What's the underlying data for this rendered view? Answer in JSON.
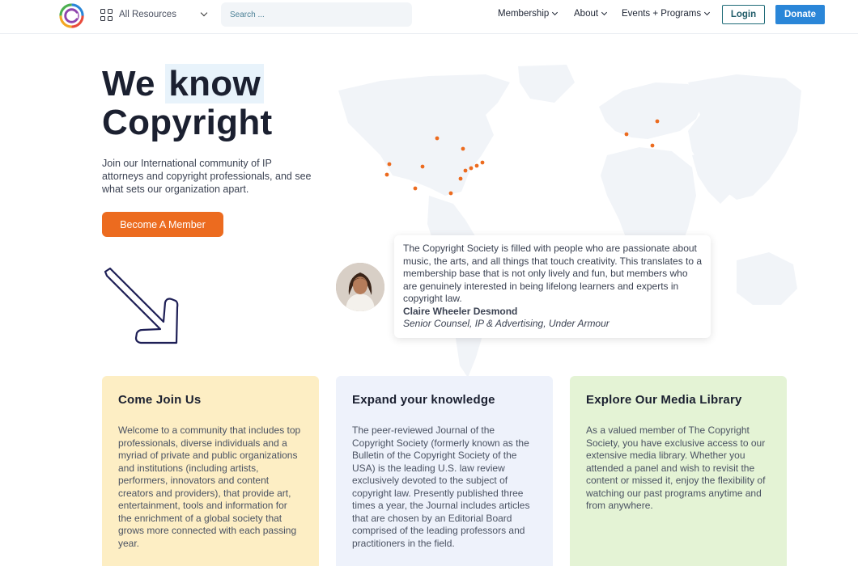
{
  "header": {
    "resources_label": "All Resources",
    "search_placeholder": "Search ...",
    "nav": [
      {
        "label": "Membership"
      },
      {
        "label": "About"
      },
      {
        "label": "Events + Programs"
      }
    ],
    "login_label": "Login",
    "donate_label": "Donate"
  },
  "hero": {
    "title_line1_a": "We",
    "title_line1_b": "know",
    "title_line2": "Copyright",
    "subtitle": "Join our International community of IP attorneys and copyright professionals, and see what sets our organization apart.",
    "cta_label": "Become A Member"
  },
  "testimonial": {
    "quote": "The Copyright Society is filled with people who are passionate about music, the arts, and all things that touch creativity. This translates to a membership base that is not only lively and fun, but members who are genuinely interested in being lifelong learners and experts in copyright law.",
    "name": "Claire Wheeler Desmond",
    "role": "Senior Counsel, IP & Advertising, Under Armour"
  },
  "cards": [
    {
      "title": "Come Join Us",
      "body": "Welcome to a community that includes top professionals, diverse individuals and a myriad of private and public organizations and institutions (including artists, performers, innovators and content creators and providers), that provide art, entertainment, tools and information for the enrichment of a global society that grows more connected with each passing year."
    },
    {
      "title": "Expand your knowledge",
      "body": "The peer-reviewed Journal of the Copyright Society (formerly known as the Bulletin of the Copyright Society of the USA) is the leading U.S. law review exclusively devoted to the subject of copyright law. Presently published three times a year, the Journal includes articles that are chosen by an Editorial Board comprised of the leading professors and practitioners in the field."
    },
    {
      "title": "Explore Our Media Library",
      "body": "As a valued member of The Copyright Society, you have exclusive access to our extensive media library. Whether you attended a panel and wish to revisit the content or missed it, enjoy the flexibility of watching our past programs anytime and from anywhere."
    }
  ],
  "colors": {
    "accent_orange": "#ec6b1f",
    "donate_blue": "#2a86d8",
    "card_yellow": "#fdeec4",
    "card_blue": "#eef2fb",
    "card_green": "#e4f3d5"
  },
  "icons": [
    "logo-icon",
    "grid-icon",
    "chevron-down-icon",
    "arrow-down-right-icon",
    "world-map"
  ]
}
